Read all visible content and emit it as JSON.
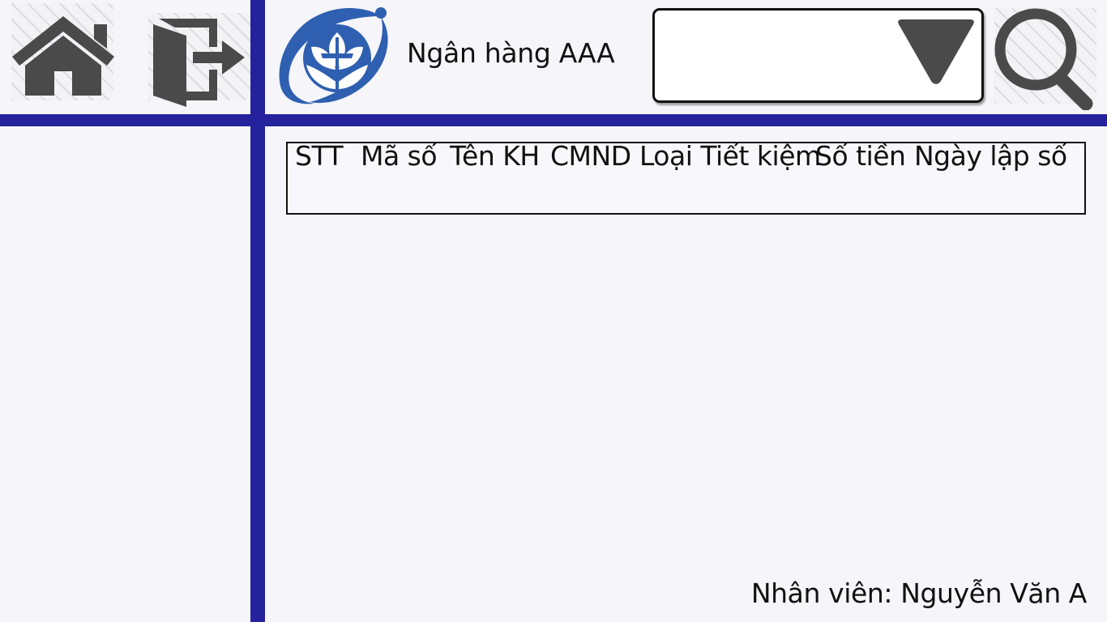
{
  "toolbar": {
    "home_icon": "home-icon",
    "logout_icon": "logout-door-arrow-icon",
    "search_icon": "magnifier-icon",
    "dropdown_icon": "triangle-down-icon"
  },
  "header": {
    "bank_name": "Ngân hàng AAA"
  },
  "search": {
    "selected_value": ""
  },
  "table": {
    "columns": [
      "STT",
      "Mã số",
      "Tên KH",
      "CMND",
      "Loại Tiết kiệm",
      "Số tiền",
      "Ngày lập số"
    ],
    "rows": []
  },
  "footer": {
    "employee": "Nhân viên: Nguyễn Văn A"
  },
  "colors": {
    "accent": "#25229d",
    "icon": "#4a4a4a",
    "logo_blue": "#2f5fb0",
    "background": "#f5f5fa"
  }
}
